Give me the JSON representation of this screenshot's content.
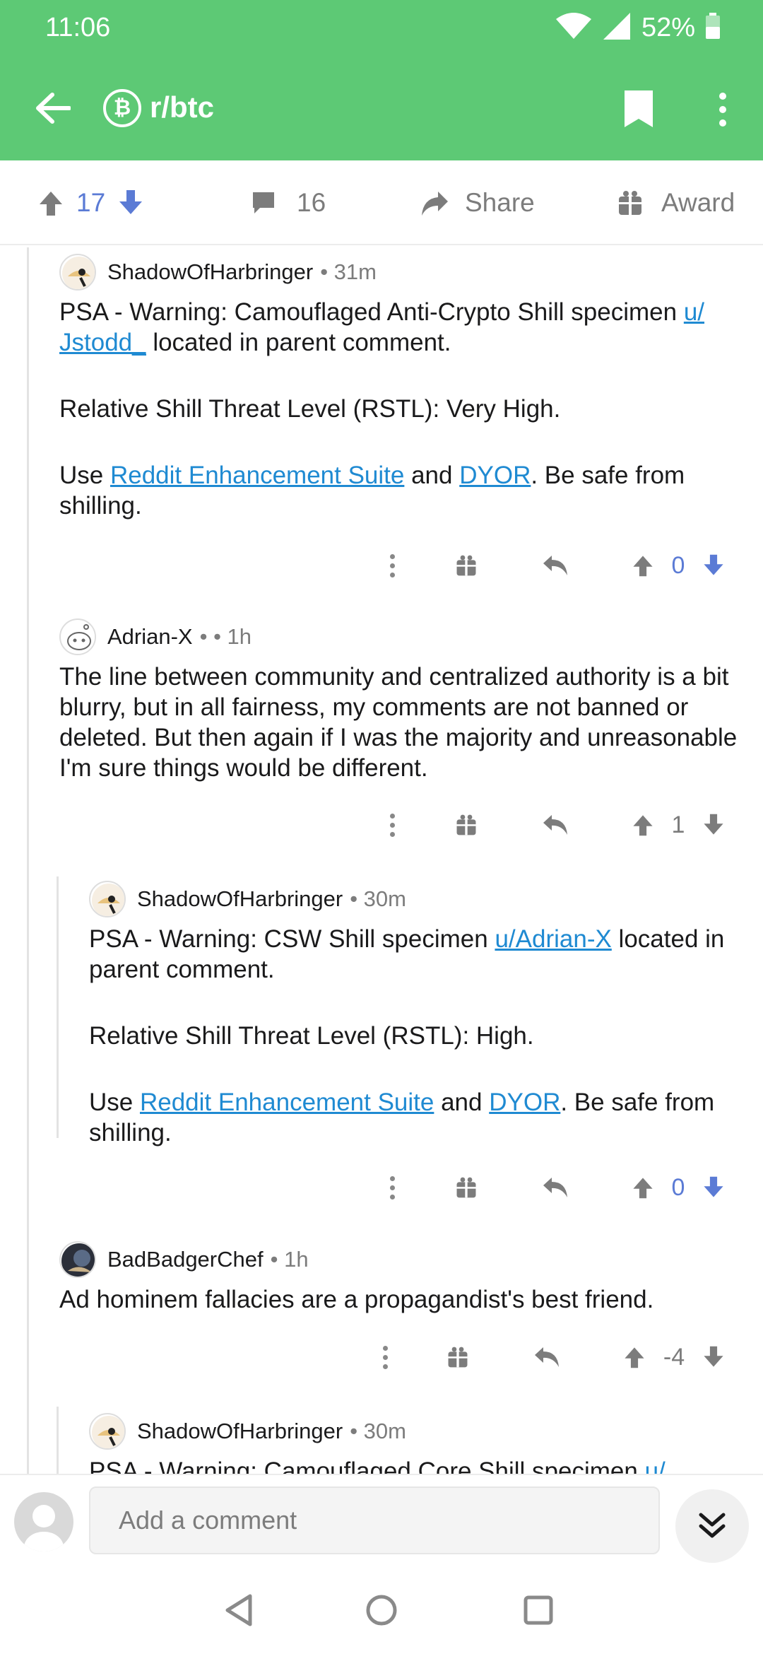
{
  "status_bar": {
    "time": "11:06",
    "battery": "52%"
  },
  "appbar": {
    "subreddit": "r/btc",
    "sub_icon_glyph": "₿"
  },
  "post_actions": {
    "upvotes": "17",
    "comments": "16",
    "share_label": "Share",
    "award_label": "Award"
  },
  "comments": [
    {
      "author": "ShadowOfHarbringer",
      "time": "• 31m",
      "lines": {
        "p1_pre": "PSA - Warning: Camouflaged Anti-Crypto Shill specimen ",
        "p1_link": "u/ Jstodd_",
        "p1_post": " located in parent comment.",
        "p2": "Relative Shill Threat Level (RSTL): Very High.",
        "p3_pre": "Use ",
        "p3_link1": "Reddit Enhancement Suite",
        "p3_mid": " and ",
        "p3_link2": "DYOR",
        "p3_post": ". Be safe from shilling."
      },
      "score": "0"
    },
    {
      "author": "Adrian-X",
      "time": "• • 1h",
      "body": "The line between community and centralized authority is a bit blurry, but in all fairness, my comments are not banned or deleted. But then again if I was the majority and unreasonable I'm sure things would be different.",
      "score": "1"
    },
    {
      "author": "ShadowOfHarbringer",
      "time": "• 30m",
      "lines": {
        "p1_pre": "PSA - Warning: CSW Shill specimen ",
        "p1_link": "u/Adrian-X",
        "p1_post": " located in parent comment.",
        "p2": "Relative Shill Threat Level (RSTL): High.",
        "p3_pre": "Use ",
        "p3_link1": "Reddit Enhancement Suite",
        "p3_mid": " and ",
        "p3_link2": "DYOR",
        "p3_post": ". Be safe from shilling."
      },
      "score": "0"
    },
    {
      "author": "BadBadgerChef",
      "time": "• 1h",
      "body": "Ad hominem fallacies are a propagandist's best friend.",
      "score": "-4"
    },
    {
      "author": "ShadowOfHarbringer",
      "time": "• 30m",
      "body_pre": "PSA - Warning: Camouflaged Core Shill specimen ",
      "body_link": "u/"
    }
  ],
  "comment_bar": {
    "placeholder": "Add a comment"
  },
  "icons": [
    "wifi-icon",
    "signal-icon",
    "battery-icon",
    "back-arrow-icon",
    "bitcoin-icon",
    "bookmark-icon",
    "more-vert-icon",
    "upvote-icon",
    "downvote-icon",
    "comment-icon",
    "share-icon",
    "gift-icon",
    "reply-icon",
    "chevrons-down-icon",
    "nav-back-icon",
    "nav-home-icon",
    "nav-recents-icon"
  ],
  "colors": {
    "header": "#5dc975",
    "vote_blue": "#5b7bd5",
    "link": "#1f8ad2"
  }
}
